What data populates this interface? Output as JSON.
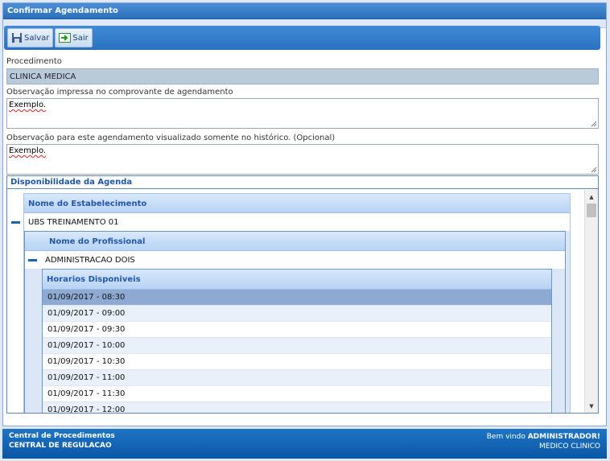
{
  "window": {
    "title": "Confirmar Agendamento"
  },
  "toolbar": {
    "save_label": "Salvar",
    "exit_label": "Sair"
  },
  "form": {
    "procedimento_label": "Procedimento",
    "procedimento_value": "CLINICA MEDICA",
    "obs_impressa_label": "Observação impressa no comprovante de agendamento",
    "obs_impressa_value": "Exemplo.",
    "obs_historico_label": "Observação para este agendamento visualizado somente no histórico. (Opcional)",
    "obs_historico_value": "Exemplo."
  },
  "agenda": {
    "title": "Disponibilidade da Agenda",
    "estab_header": "Nome do Estabelecimento",
    "estab_value": "UBS TREINAMENTO 01",
    "prof_header": "Nome do Profissional",
    "prof_value": "ADMINISTRACAO DOIS",
    "horarios_header": "Horarios Disponiveis",
    "horarios": [
      "01/09/2017 - 08:30",
      "01/09/2017 - 09:00",
      "01/09/2017 - 09:30",
      "01/09/2017 - 10:00",
      "01/09/2017 - 10:30",
      "01/09/2017 - 11:00",
      "01/09/2017 - 11:30",
      "01/09/2017 - 12:00"
    ],
    "selected_index": 0
  },
  "status": {
    "left_line1": "Central de Procedimentos",
    "left_line2": "CENTRAL DE REGULACAO",
    "welcome_prefix": "Bem vindo ",
    "user": "ADMINISTRADOR!",
    "role": "MEDICO CLINICO"
  },
  "colors": {
    "accent": "#2b6fb8",
    "selected_row": "#8eaad3"
  }
}
